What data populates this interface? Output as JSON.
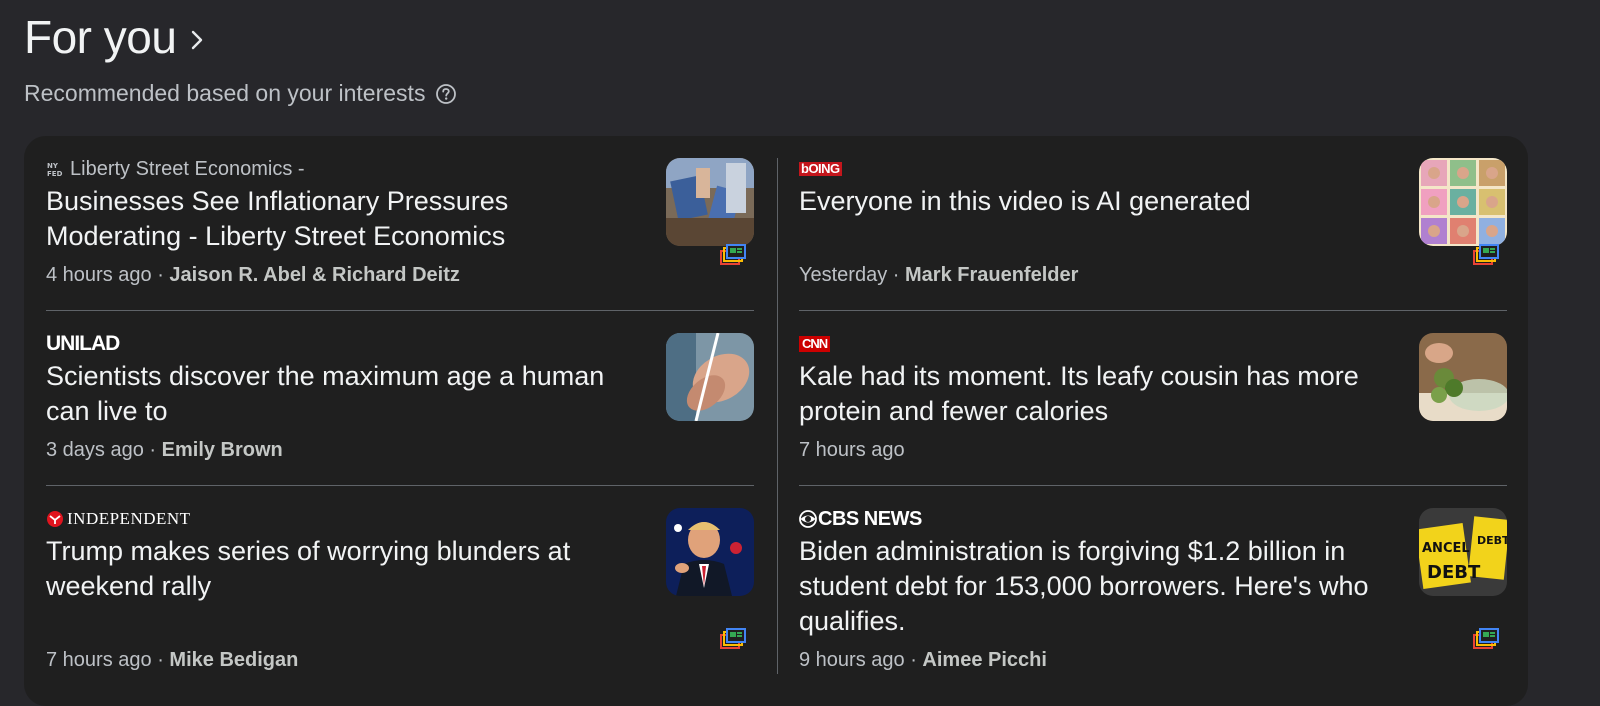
{
  "section": {
    "title": "For you",
    "subtitle": "Recommended based on your interests"
  },
  "stories_left": [
    {
      "publisher": "Liberty Street Economics -",
      "headline": "Businesses See Inflationary Pressures Moderating - Liberty Street Economics",
      "time": "4 hours ago",
      "author": "Jaison R. Abel & Richard Deitz"
    },
    {
      "publisher": "UNILAD",
      "headline": "Scientists discover the maximum age a human can live to",
      "time": "3 days ago",
      "author": "Emily Brown"
    },
    {
      "publisher": "INDEPENDENT",
      "headline": "Trump makes series of worrying blunders at weekend rally",
      "time": "7 hours ago",
      "author": "Mike Bedigan"
    }
  ],
  "stories_right": [
    {
      "publisher": "bOING",
      "headline": "Everyone in this video is AI generated",
      "time": "Yesterday",
      "author": "Mark Frauenfelder"
    },
    {
      "publisher": "CNN",
      "headline": "Kale had its moment. Its leafy cousin has more protein and fewer calories",
      "time": "7 hours ago",
      "author": ""
    },
    {
      "publisher": "CBS NEWS",
      "headline": "Biden administration is forgiving $1.2 billion in student debt for 153,000 borrowers. Here's who qualifies.",
      "time": "9 hours ago",
      "author": "Aimee Picchi"
    }
  ],
  "icons": {
    "chevron": "chevron-right-icon",
    "help": "help-circle-icon",
    "full_coverage": "full-coverage-icon"
  },
  "colors": {
    "background": "#27272b",
    "card": "#1f1f1f",
    "cnn_red": "#cc0000",
    "independent_red": "#e0141e"
  }
}
